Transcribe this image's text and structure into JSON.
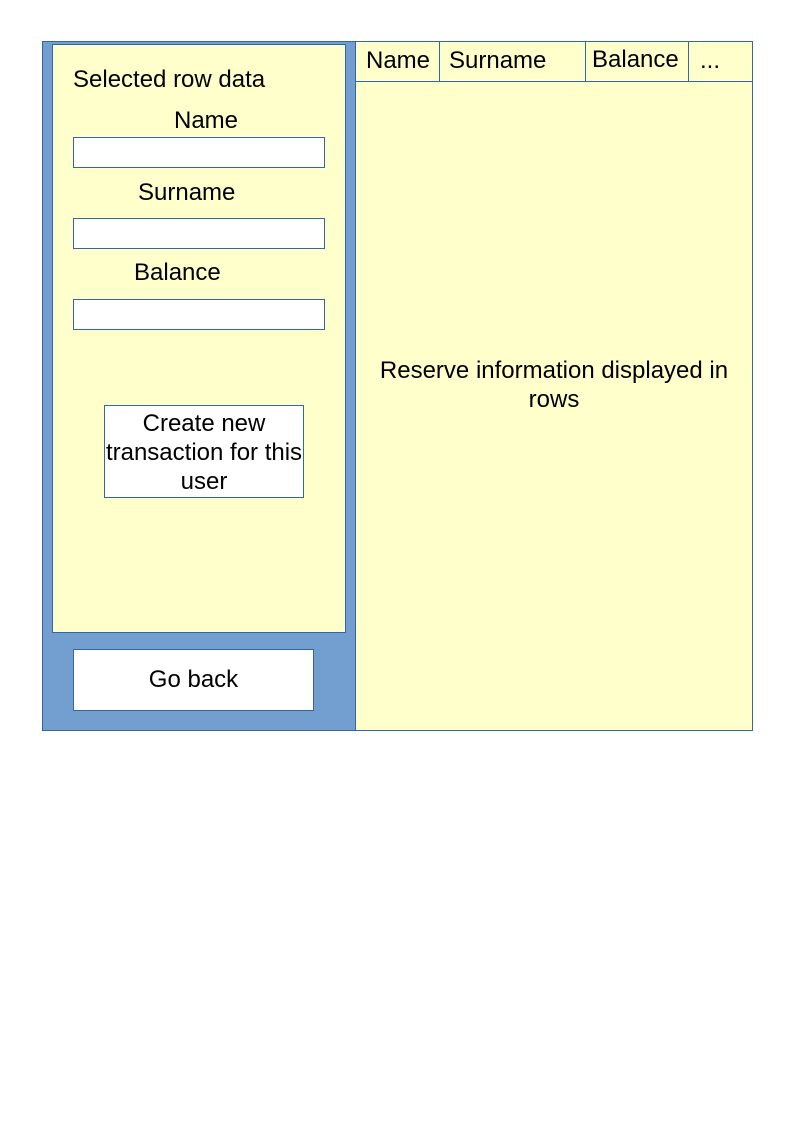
{
  "detail_panel": {
    "title": "Selected row data",
    "fields": [
      {
        "label": "Name",
        "value": "",
        "placeholder": ""
      },
      {
        "label": "Surname",
        "value": "",
        "placeholder": ""
      },
      {
        "label": "Balance",
        "value": "",
        "placeholder": ""
      }
    ],
    "create_transaction_label": "Create new transaction for this user"
  },
  "go_back_label": "Go back",
  "table": {
    "columns": [
      "Name",
      "Surname",
      "Balance",
      "..."
    ],
    "placeholder": "Reserve information displayed in rows"
  },
  "colors": {
    "panel_background": "#ffffcc",
    "sidebar_background": "#729fcf",
    "border": "#3465a4"
  }
}
